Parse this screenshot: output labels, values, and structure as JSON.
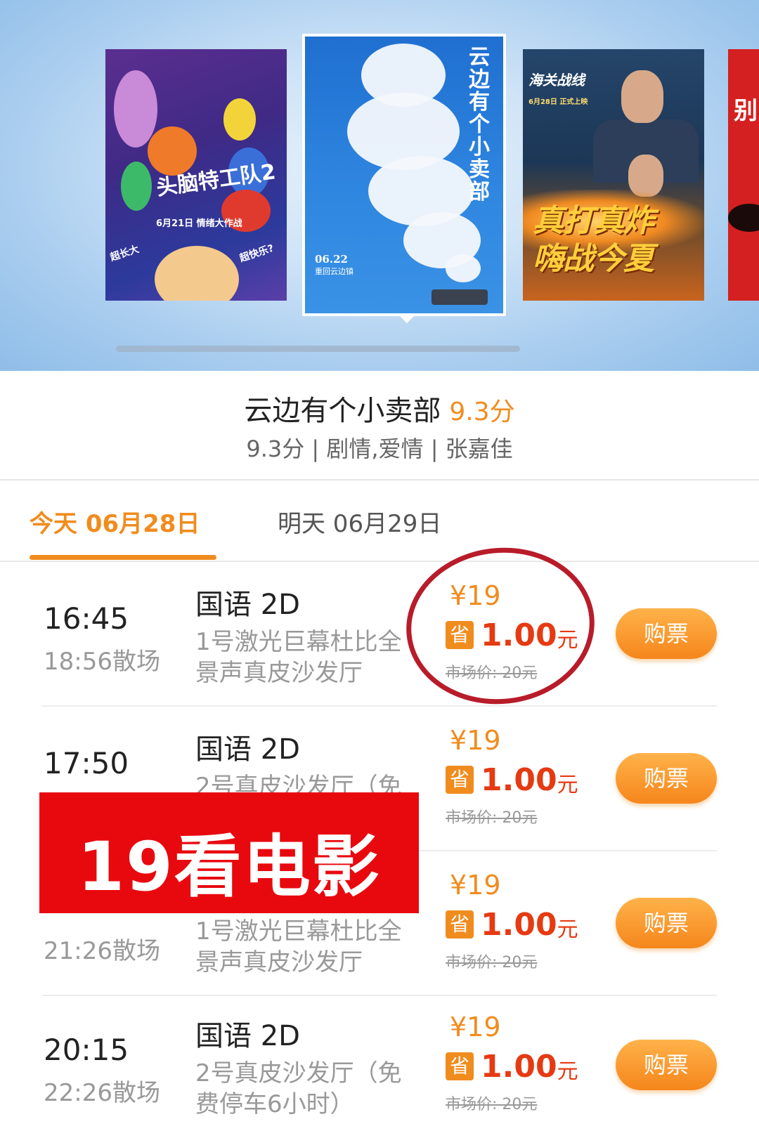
{
  "carousel": {
    "posters": [
      {
        "title": "头脑特工队2",
        "date": "6月21日 情绪大作战",
        "tagline_left": "超长大",
        "tagline_right": "超快乐?"
      },
      {
        "title": "云边有个小卖部",
        "date": "06.22",
        "subtitle": "重回云边镇"
      },
      {
        "title": "海关战线",
        "date": "6月28日 正式上映",
        "slogan_line1": "真打真炸",
        "slogan_line2": "嗨战今夏"
      },
      {
        "title": "别"
      }
    ]
  },
  "movie": {
    "title": "云边有个小卖部",
    "score": "9.3分",
    "meta": "9.3分 | 剧情,爱情 | 张嘉佳"
  },
  "tabs": {
    "today": "今天 06月28日",
    "tomorrow": "明天 06月29日"
  },
  "showtimes": [
    {
      "start": "16:45",
      "end": "18:56散场",
      "lang": "国语 2D",
      "hall": "1号激光巨幕杜比全景声真皮沙发厅",
      "price": "¥19",
      "save_badge": "省",
      "save_amount": "1.00",
      "save_unit": "元",
      "market_price": "市场价: 20元",
      "buy_label": "购票"
    },
    {
      "start": "17:50",
      "end": "",
      "lang": "国语 2D",
      "hall": "2号真皮沙发厅（免",
      "price": "¥19",
      "save_badge": "省",
      "save_amount": "1.00",
      "save_unit": "元",
      "market_price": "市场价: 20元",
      "buy_label": "购票"
    },
    {
      "start": "",
      "end": "21:26散场",
      "lang": "",
      "hall": "1号激光巨幕杜比全景声真皮沙发厅",
      "price": "¥19",
      "save_badge": "省",
      "save_amount": "1.00",
      "save_unit": "元",
      "market_price": "市场价: 20元",
      "buy_label": "购票"
    },
    {
      "start": "20:15",
      "end": "22:26散场",
      "lang": "国语 2D",
      "hall": "2号真皮沙发厅（免费停车6小时）",
      "price": "¥19",
      "save_badge": "省",
      "save_amount": "1.00",
      "save_unit": "元",
      "market_price": "市场价: 20元",
      "buy_label": "购票"
    }
  ],
  "promo": {
    "text": "19看电影"
  },
  "colors": {
    "accent": "#f08c1e",
    "save_red": "#e63a12",
    "promo_red": "#e8090f",
    "circle_mark": "#b81c2a"
  }
}
